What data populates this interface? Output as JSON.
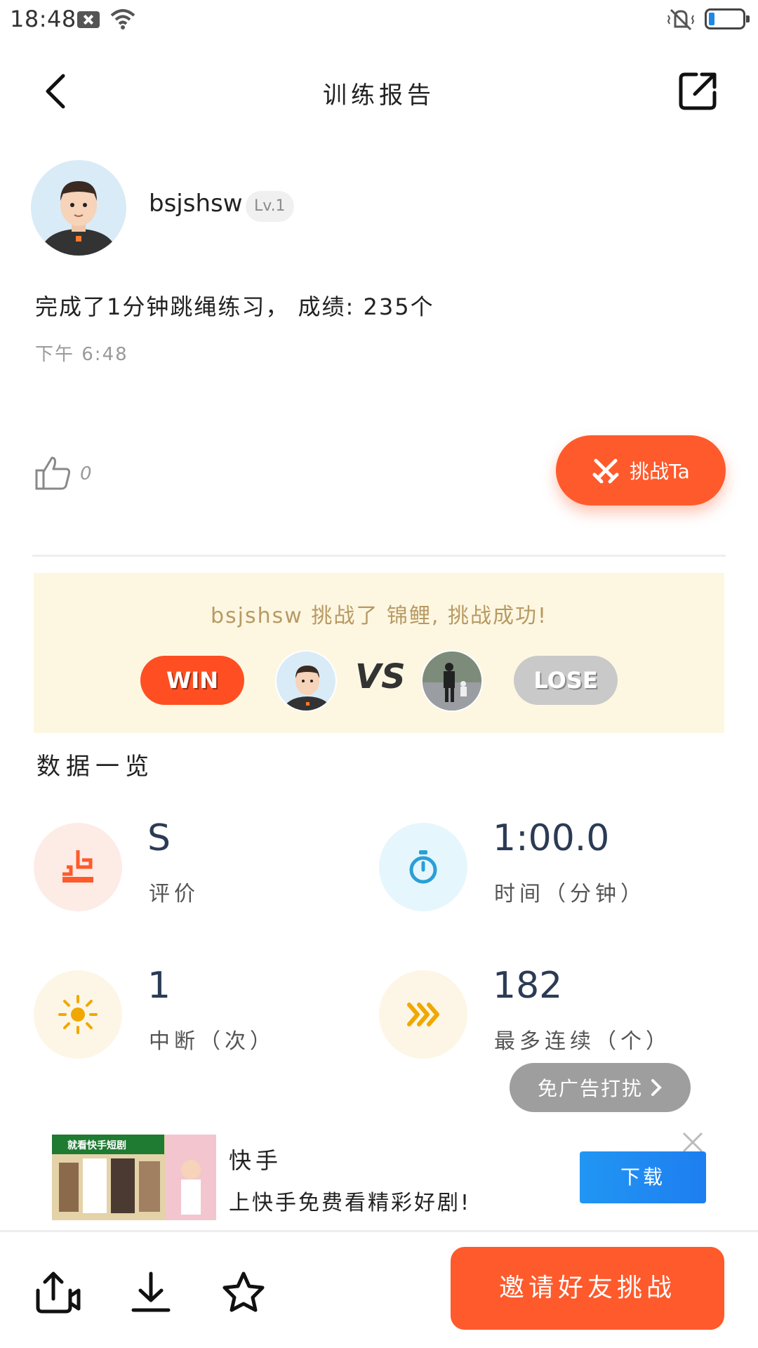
{
  "status_bar": {
    "time": "18:48"
  },
  "header": {
    "title": "训练报告"
  },
  "profile": {
    "username": "bsjshsw",
    "level": "Lv.1",
    "summary": "完成了1分钟跳绳练习， 成绩: 235个",
    "time": "下午 6:48"
  },
  "actions": {
    "like_count": "0",
    "challenge_label": "挑战Ta"
  },
  "result": {
    "text": "bsjshsw 挑战了 锦鲤, 挑战成功!",
    "win_label": "WIN",
    "vs_label": "VS",
    "lose_label": "LOSE"
  },
  "stats": {
    "section_title": "数据一览",
    "items": [
      {
        "value": "S",
        "label": "评价",
        "icon": "rating-icon",
        "color": "#ff5a2c",
        "bg": "#fdece6"
      },
      {
        "value": "1:00.0",
        "label": "时间（分钟）",
        "icon": "stopwatch-icon",
        "color": "#2a9fd6",
        "bg": "#e6f6fd"
      },
      {
        "value": "1",
        "label": "中断（次）",
        "icon": "sun-icon",
        "color": "#f0a800",
        "bg": "#fdf6e6"
      },
      {
        "value": "182",
        "label": "最多连续（个）",
        "icon": "chevrons-icon",
        "color": "#f0a800",
        "bg": "#fdf6e6"
      }
    ]
  },
  "ad": {
    "no_ads_label": "免广告打扰",
    "brand": "快手",
    "description": "上快手免费看精彩好剧!",
    "download_label": "下载",
    "image_caption": "就看快手短剧"
  },
  "bottom_bar": {
    "invite_label": "邀请好友挑战"
  },
  "colors": {
    "accent": "#ff5a2c",
    "blue": "#2196f3",
    "card_bg": "#fdf7e2"
  }
}
